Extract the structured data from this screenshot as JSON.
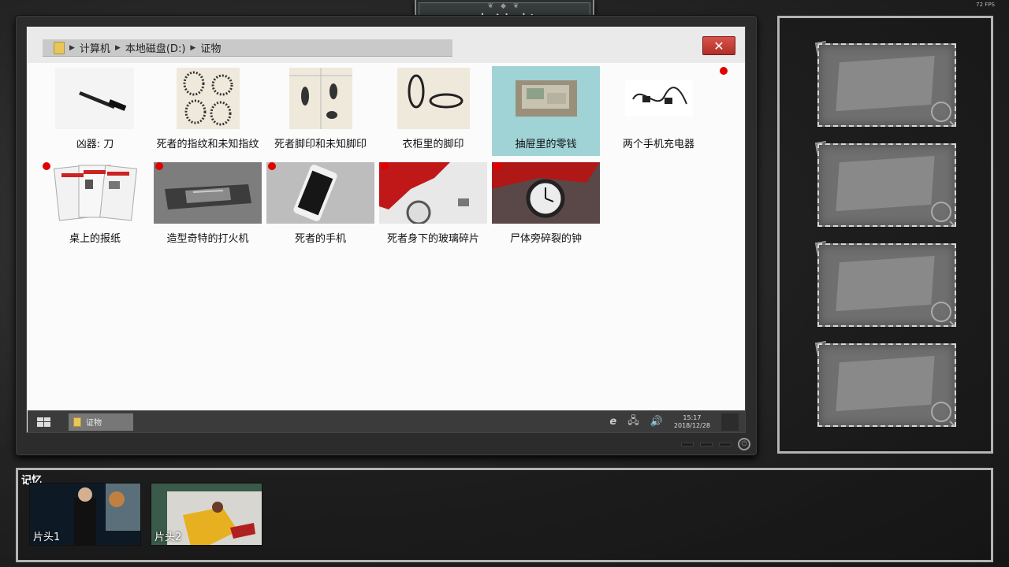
{
  "fps": "72 FPS",
  "title": "来访者",
  "explorer": {
    "breadcrumb": [
      "计算机",
      "本地磁盘(D:)",
      "证物"
    ],
    "close_label": "✕",
    "items": [
      {
        "label": "凶器: 刀",
        "new": false,
        "selected": false
      },
      {
        "label": "死者的指纹和未知指纹",
        "new": false,
        "selected": false
      },
      {
        "label": "死者脚印和未知脚印",
        "new": false,
        "selected": false
      },
      {
        "label": "衣柜里的脚印",
        "new": false,
        "selected": false
      },
      {
        "label": "抽屉里的零钱",
        "new": false,
        "selected": true
      },
      {
        "label": "两个手机充电器",
        "new": true,
        "selected": false
      },
      {
        "label": "桌上的报纸",
        "new": true,
        "selected": false
      },
      {
        "label": "造型奇特的打火机",
        "new": true,
        "selected": false
      },
      {
        "label": "死者的手机",
        "new": true,
        "selected": false
      },
      {
        "label": "死者身下的玻璃碎片",
        "new": true,
        "selected": false
      },
      {
        "label": "尸体旁碎裂的钟",
        "new": true,
        "selected": false
      }
    ]
  },
  "taskbar": {
    "task_label": "证物",
    "time": "15:17",
    "date": "2018/12/28"
  },
  "memory": {
    "title": "记忆",
    "items": [
      "片头1",
      "片头2"
    ]
  }
}
